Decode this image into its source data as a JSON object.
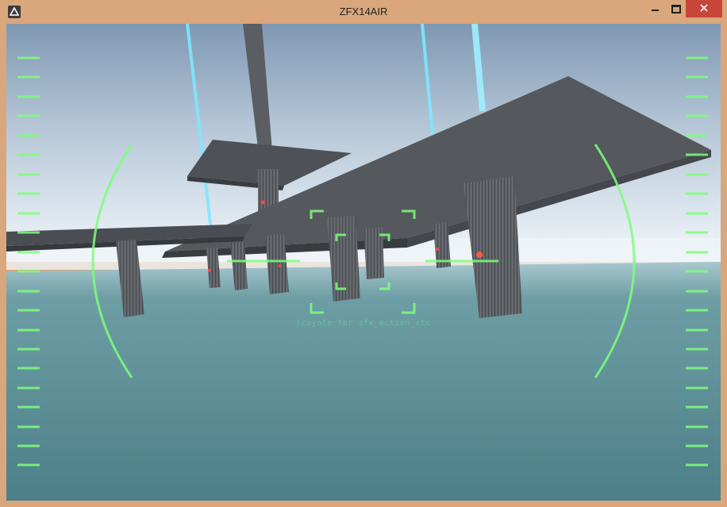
{
  "window": {
    "title": "ZFX14AIR",
    "icons": {
      "app": "app-logo-icon",
      "minimize": "minimize-icon",
      "maximize": "maximize-icon",
      "close": "close-icon"
    }
  },
  "hud": {
    "status_text": "[coyote for zfx_action_xtc",
    "color": "#7dff7a"
  },
  "scene": {
    "sky_color": "#9fb6c9",
    "water_color": "#5c8c93",
    "structure_color": "#55595d",
    "beam_color": "#7ee7ff"
  }
}
